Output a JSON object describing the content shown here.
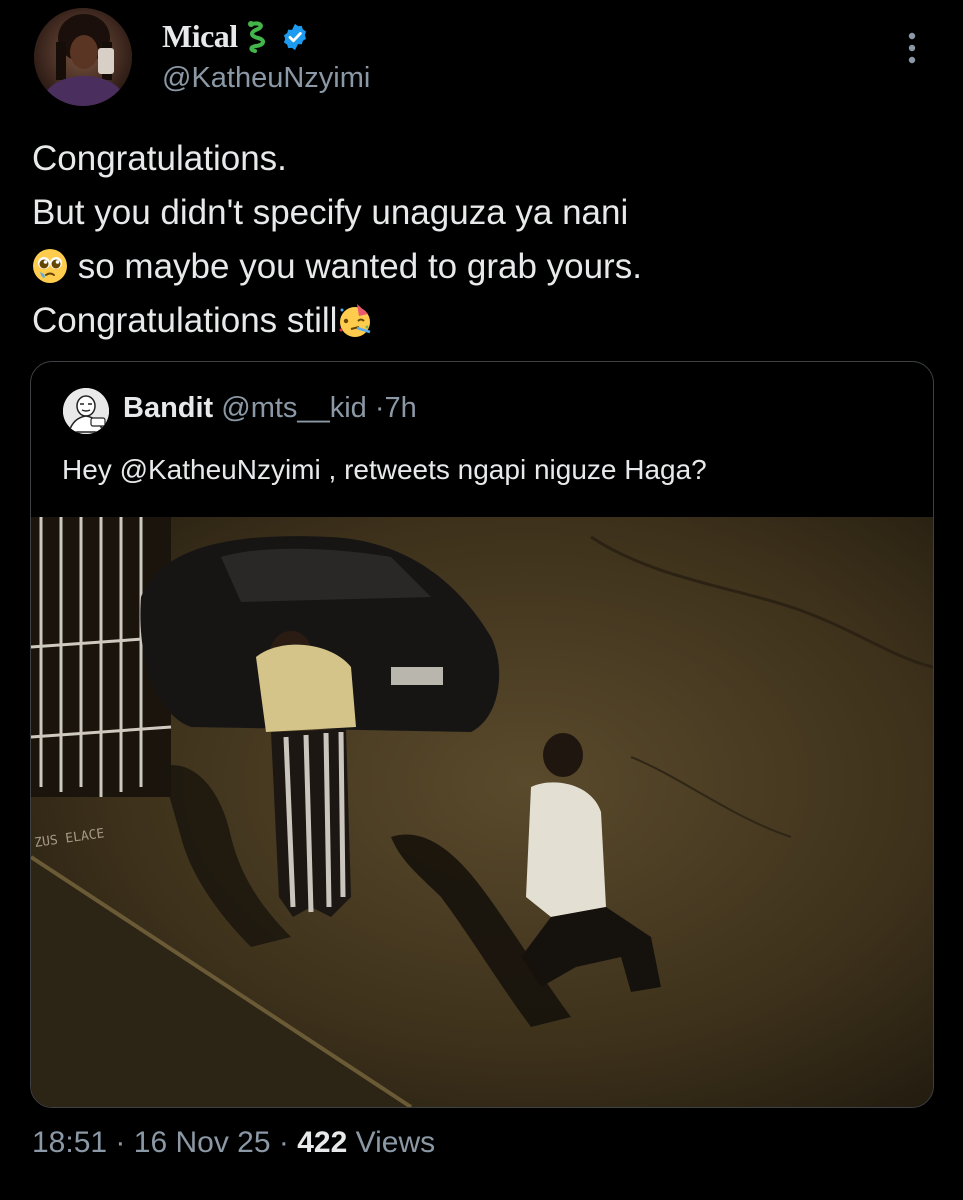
{
  "author": {
    "display_name": "Mical",
    "handle": "@KatheuNzyimi",
    "name_emoji_icon": "snake-icon",
    "verified_icon": "verified-badge-icon",
    "verified_color": "#1d9bf0"
  },
  "tweet": {
    "lines": [
      "Congratulations.",
      "But you didn't specify unaguza ya nani",
      "so maybe you wanted to grab yours.",
      "Congratulations still"
    ],
    "line3_emoji_icon": "pleading-face-icon",
    "line4_emoji_icon": "partying-face-icon"
  },
  "quote": {
    "name": "Bandit",
    "handle": "@mts__kid",
    "separator": "·",
    "age": "7h",
    "text": "Hey @KatheuNzyimi , retweets ngapi niguze Haga?",
    "media_icon": "photo-night-street-icon",
    "media_overlay_text": "ZUS ELACE"
  },
  "meta": {
    "time": "18:51",
    "date": "16 Nov 25",
    "views_count": "422",
    "views_label": "Views",
    "separator": "·"
  },
  "colors": {
    "background": "#000000",
    "text_primary": "#e7e9ea",
    "text_secondary": "#8b98a5",
    "border": "#3e4144"
  }
}
